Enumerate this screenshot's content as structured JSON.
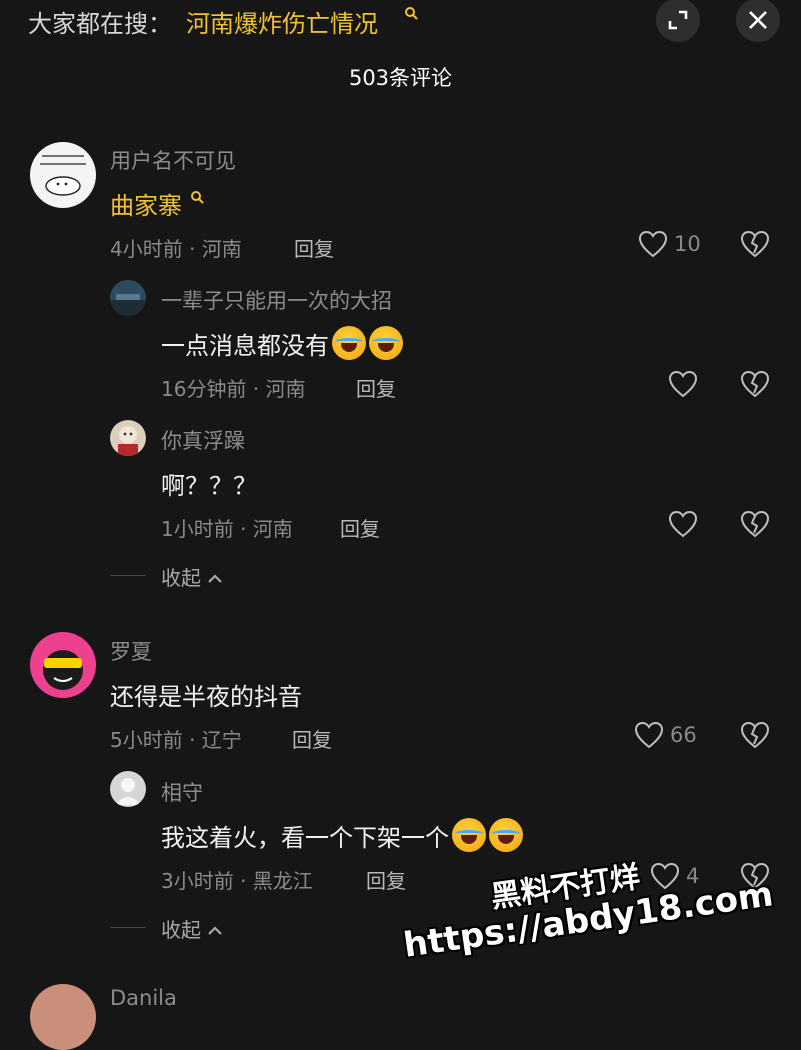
{
  "header": {
    "search_prefix": "大家都在搜：",
    "search_query": "河南爆炸伤亡情况",
    "comment_count": "503条评论"
  },
  "comments": [
    {
      "username": "用户名不可见",
      "text": "曲家寨",
      "meta": "4小时前 · 河南",
      "reply_label": "回复",
      "likes": "10"
    },
    {
      "username": "一辈子只能用一次的大招",
      "text": "一点消息都没有",
      "meta": "16分钟前 · 河南",
      "reply_label": "回复"
    },
    {
      "username": "你真浮躁",
      "text": "啊？？？",
      "meta": "1小时前 · 河南",
      "reply_label": "回复"
    },
    {
      "username": "罗夏",
      "text": "还得是半夜的抖音",
      "meta": "5小时前 · 辽宁",
      "reply_label": "回复",
      "likes": "66"
    },
    {
      "username": "相守",
      "text": "我这着火，看一个下架一个",
      "meta": "3小时前 · 黑龙江",
      "reply_label": "回复",
      "likes": "4"
    },
    {
      "username": "Danila"
    }
  ],
  "collapse_label": "收起",
  "watermark": {
    "line1": "黑料不打烊",
    "line2": "https://abdy18.com"
  },
  "colors": {
    "background": "#161616",
    "accent": "#f2c230"
  },
  "icons": [
    "expand-icon",
    "close-icon",
    "search-icon",
    "heart-icon",
    "broken-heart-icon",
    "chevron-up-icon",
    "laughing-crying-emoji"
  ]
}
